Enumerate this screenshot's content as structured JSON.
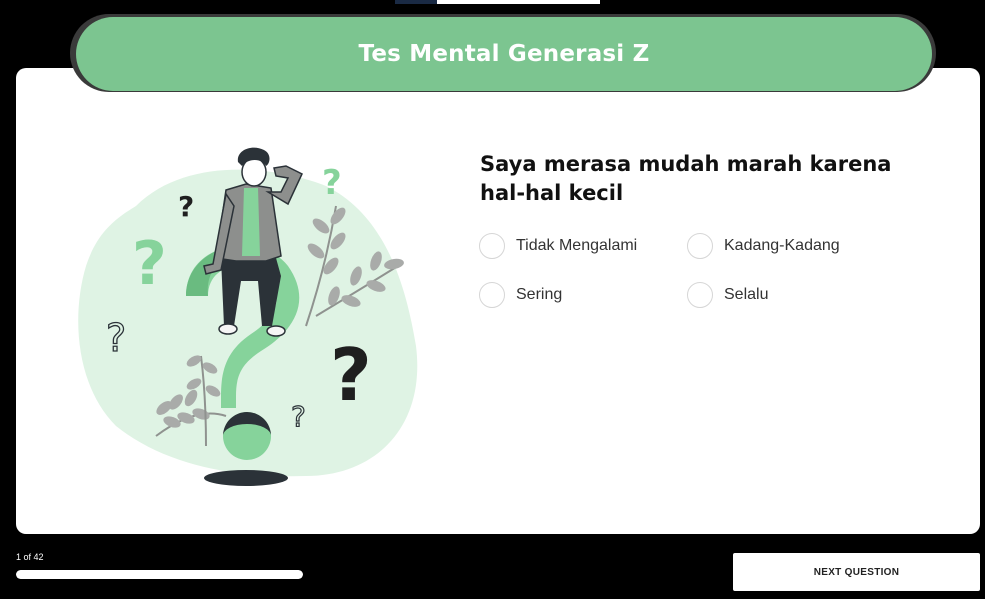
{
  "header": {
    "title": "Tes Mental Generasi Z"
  },
  "question": {
    "text": "Saya merasa mudah marah karena hal-hal kecil",
    "options": [
      {
        "label": "Tidak Mengalami"
      },
      {
        "label": "Kadang-Kadang"
      },
      {
        "label": "Sering"
      },
      {
        "label": "Selalu"
      }
    ]
  },
  "progress": {
    "label": "1 of 42",
    "current": 1,
    "total": 42,
    "fraction": 1.0
  },
  "footer": {
    "next_label": "NEXT QUESTION"
  },
  "colors": {
    "accent": "#7cc590",
    "blob": "#dff3e4",
    "dark": "#2b3238"
  }
}
